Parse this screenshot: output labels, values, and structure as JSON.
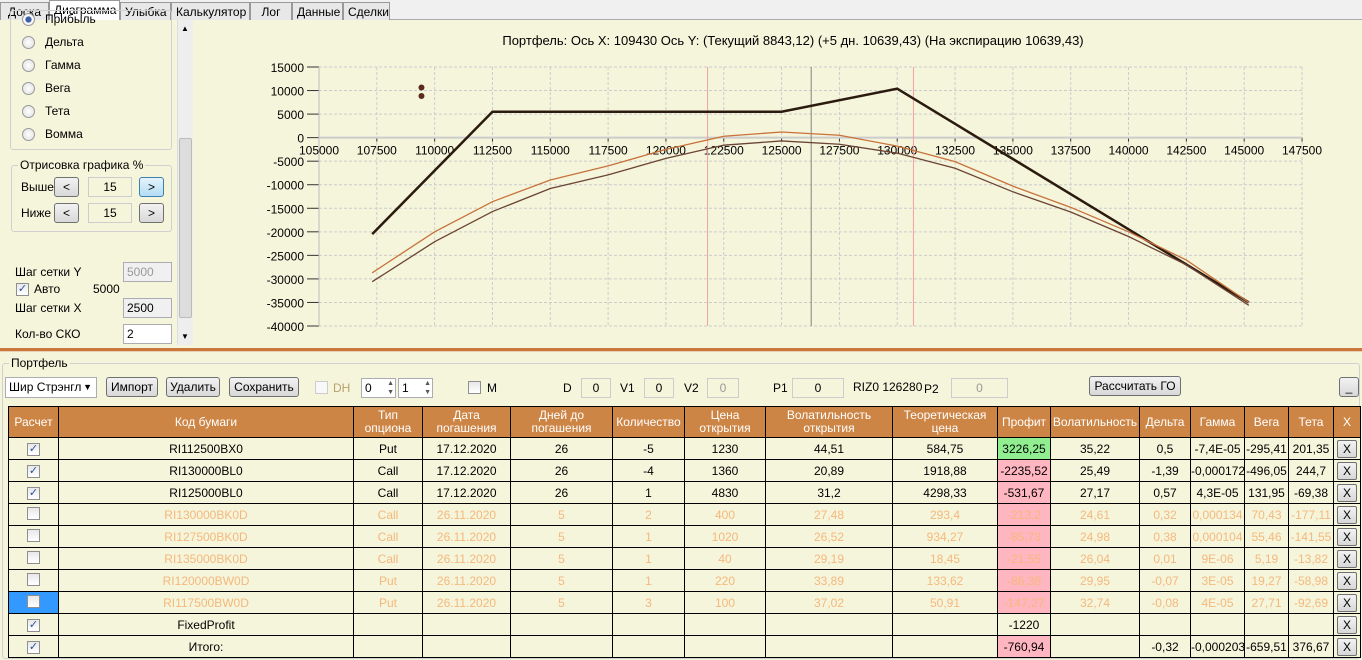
{
  "tabs": [
    "Доска",
    "Диаграмма",
    "Улыбка",
    "Калькулятор",
    "Лог",
    "Данные",
    "Сделки"
  ],
  "active_tab": "Диаграмма",
  "left_panel": {
    "radios": [
      "Прибыль",
      "Дельта",
      "Гамма",
      "Вега",
      "Тета",
      "Вомма"
    ],
    "selected_radio": "Прибыль",
    "draw_group": {
      "title": "Отрисовка графика %",
      "above_label": "Выше",
      "above_value": "15",
      "below_label": "Ниже",
      "below_value": "15",
      "dec": "<",
      "inc": ">"
    },
    "grid_y_label": "Шаг сетки Y",
    "grid_y_value": "5000",
    "auto_label": "Авто",
    "auto_checked": true,
    "auto_value": "5000",
    "grid_x_label": "Шаг сетки X",
    "grid_x_value": "2500",
    "sko_label": "Кол-во СКО",
    "sko_value": "2"
  },
  "chart_data": {
    "type": "line",
    "title": "Портфель: Ось X:  109430 Ось Y:   (Текущий 8843,12)   (+5 дн. 10639,43)   (На экспирацию 10639,43)",
    "xlim": [
      105000,
      147500
    ],
    "ylim": [
      -40000,
      15000
    ],
    "xticks": [
      105000,
      107500,
      110000,
      112500,
      115000,
      117500,
      120000,
      122500,
      125000,
      127500,
      130000,
      132500,
      135000,
      137500,
      140000,
      142500,
      145000,
      147500
    ],
    "yticks": [
      15000,
      10000,
      5000,
      0,
      -5000,
      -10000,
      -15000,
      -20000,
      -25000,
      -30000,
      -35000,
      -40000
    ],
    "grid": true,
    "series": [
      {
        "color": "#2b1a0e",
        "x": [
          107300,
          112500,
          125000,
          130000,
          145200
        ],
        "y": [
          -20500,
          5500,
          5500,
          10400,
          -35000
        ]
      },
      {
        "color": "#c8713a",
        "x": [
          107300,
          110000,
          112500,
          115000,
          117500,
          120000,
          122500,
          125000,
          127500,
          130000,
          132500,
          135000,
          137500,
          140000,
          142500,
          145200
        ],
        "y": [
          -28700,
          -20000,
          -13600,
          -9000,
          -6000,
          -2500,
          300,
          1200,
          500,
          -1800,
          -5100,
          -10300,
          -14800,
          -20000,
          -26000,
          -35000
        ]
      },
      {
        "color": "#6b4433",
        "x": [
          107300,
          110000,
          112500,
          115000,
          117500,
          120000,
          122500,
          125000,
          127500,
          130000,
          132500,
          135000,
          137500,
          140000,
          142500,
          145200
        ],
        "y": [
          -30600,
          -22100,
          -15700,
          -10800,
          -7900,
          -4400,
          -1600,
          -700,
          -1400,
          -3300,
          -6500,
          -11500,
          -15800,
          -21000,
          -27000,
          -35600
        ]
      }
    ],
    "points": [
      {
        "x": 109430,
        "y": 10639.43,
        "color": "#5a2a1a"
      },
      {
        "x": 109430,
        "y": 8843.12,
        "color": "#5a2a1a"
      }
    ],
    "vlines": [
      {
        "x": 121800,
        "color": "#f4a0a0"
      },
      {
        "x": 126280,
        "color": "#7a8a7a"
      },
      {
        "x": 130700,
        "color": "#f4a0a0"
      }
    ]
  },
  "portfolio": {
    "title": "Портфель",
    "strategy": "Шир Стрэнгл",
    "import": "Импорт",
    "delete": "Удалить",
    "save": "Сохранить",
    "dh_label": "DH",
    "spin1": "0",
    "spin2": "1",
    "m_label": "M",
    "d_label": "D",
    "d_value": "0",
    "v1_label": "V1",
    "v1_value": "0",
    "v2_label": "V2",
    "v2_value": "0",
    "p1_label": "P1",
    "p1_value": "0",
    "riz_label": "RIZ0 126280",
    "p2_label": "P2",
    "p2_value": "0",
    "calc_go": "Рассчитать ГО",
    "minimize": "_"
  },
  "table": {
    "headers": [
      "Расчет",
      "Код бумаги",
      "Тип опциона",
      "Дата погашения",
      "Дней до погашения",
      "Количество",
      "Цена открытия",
      "Волатильность открытия",
      "Теоретическая цена",
      "Профит",
      "Волатильность",
      "Дельта",
      "Гамма",
      "Вега",
      "Тета",
      "X"
    ],
    "rows": [
      {
        "checked": true,
        "active": true,
        "cells": [
          "RI112500BX0",
          "Put",
          "17.12.2020",
          "26",
          "-5",
          "1230",
          "44,51",
          "584,75",
          "3226,25",
          "35,22",
          "0,5",
          "-7,4E-05",
          "-295,41",
          "201,35"
        ],
        "profit": "pos"
      },
      {
        "checked": true,
        "active": true,
        "cells": [
          "RI130000BL0",
          "Call",
          "17.12.2020",
          "26",
          "-4",
          "1360",
          "20,89",
          "1918,88",
          "-2235,52",
          "25,49",
          "-1,39",
          "-0,000172",
          "-496,05",
          "244,7"
        ],
        "profit": "neg"
      },
      {
        "checked": true,
        "active": true,
        "cells": [
          "RI125000BL0",
          "Call",
          "17.12.2020",
          "26",
          "1",
          "4830",
          "31,2",
          "4298,33",
          "-531,67",
          "27,17",
          "0,57",
          "4,3E-05",
          "131,95",
          "-69,38"
        ],
        "profit": "neg"
      },
      {
        "checked": false,
        "active": false,
        "cells": [
          "RI130000BK0D",
          "Call",
          "26.11.2020",
          "5",
          "2",
          "400",
          "27,48",
          "293,4",
          "-213,2",
          "24,61",
          "0,32",
          "0,000134",
          "70,43",
          "-177,11"
        ],
        "profit": "neg"
      },
      {
        "checked": false,
        "active": false,
        "cells": [
          "RI127500BK0D",
          "Call",
          "26.11.2020",
          "5",
          "1",
          "1020",
          "26,52",
          "934,27",
          "-85,73",
          "24,98",
          "0,38",
          "0,000104",
          "55,46",
          "-141,55"
        ],
        "profit": "neg"
      },
      {
        "checked": false,
        "active": false,
        "cells": [
          "RI135000BK0D",
          "Call",
          "26.11.2020",
          "5",
          "1",
          "40",
          "29,19",
          "18,45",
          "-21,55",
          "26,04",
          "0,01",
          "9E-06",
          "5,19",
          "-13,82"
        ],
        "profit": "neg"
      },
      {
        "checked": false,
        "active": false,
        "cells": [
          "RI120000BW0D",
          "Put",
          "26.11.2020",
          "5",
          "1",
          "220",
          "33,89",
          "133,62",
          "-86,38",
          "29,95",
          "-0,07",
          "3E-05",
          "19,27",
          "-58,98"
        ],
        "profit": "neg"
      },
      {
        "checked": false,
        "active": false,
        "selected": true,
        "cells": [
          "RI117500BW0D",
          "Put",
          "26.11.2020",
          "5",
          "3",
          "100",
          "37,02",
          "50,91",
          "-147,27",
          "32,74",
          "-0,08",
          "4E-05",
          "27,71",
          "-92,69"
        ],
        "profit": "neg"
      },
      {
        "checked": true,
        "active": true,
        "cells": [
          "FixedProfit",
          "",
          "",
          "",
          "",
          "",
          "",
          "",
          "-1220",
          "",
          "",
          "",
          "",
          ""
        ],
        "profit": ""
      },
      {
        "checked": true,
        "active": true,
        "cells": [
          "Итого:",
          "",
          "",
          "",
          "",
          "",
          "",
          "",
          "-760,94",
          "",
          "-0,32",
          "-0,000203",
          "-659,51",
          "376,67"
        ],
        "profit": "neg"
      }
    ],
    "delete_label": "X"
  }
}
